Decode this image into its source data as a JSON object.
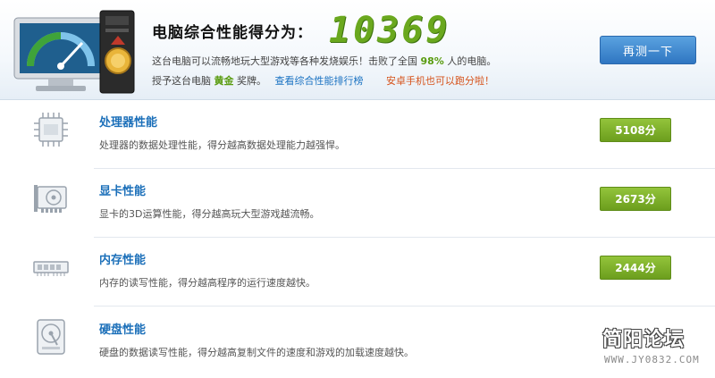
{
  "header": {
    "title": "电脑综合性能得分为：",
    "score": "10369",
    "line1_text": "这台电脑可以流畅地玩大型游戏等各种发烧娱乐！击败了全国",
    "line1_percent": "98%",
    "line1_suffix": "人的电脑。",
    "line2_prefix": "授予这台电脑",
    "line2_medal": "黄金",
    "line2_suffix": "奖牌。",
    "rank_link": "查看综合性能排行榜",
    "android_link": "安卓手机也可以跑分啦！",
    "retest_label": "再测一下"
  },
  "rows": [
    {
      "icon": "cpu-icon",
      "name": "处理器性能",
      "desc": "处理器的数据处理性能，得分越高数据处理能力越强悍。",
      "score": "5108分"
    },
    {
      "icon": "graphics-card-icon",
      "name": "显卡性能",
      "desc": "显卡的3D运算性能，得分越高玩大型游戏越流畅。",
      "score": "2673分"
    },
    {
      "icon": "memory-icon",
      "name": "内存性能",
      "desc": "内存的读写性能，得分越高程序的运行速度越快。",
      "score": "2444分"
    },
    {
      "icon": "hard-disk-icon",
      "name": "硬盘性能",
      "desc": "硬盘的数据读写性能，得分越高复制文件的速度和游戏的加载速度越快。",
      "score": ""
    }
  ],
  "watermark": {
    "main": "简阳论坛",
    "site": "WWW.JY0832.COM"
  },
  "colors": {
    "accent_green": "#6aa81e",
    "link_blue": "#1b6fb9",
    "button_blue": "#2f76c2",
    "warning_orange": "#d6531c"
  }
}
